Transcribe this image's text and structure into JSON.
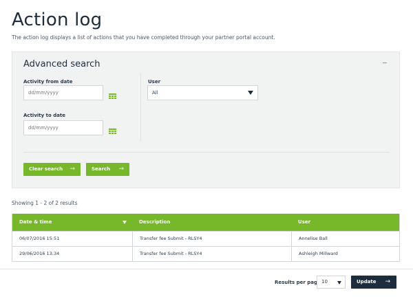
{
  "page": {
    "title": "Action log",
    "intro": "The action log displays a list of actions that you have completed through your partner portal account."
  },
  "advanced_search": {
    "title": "Advanced search",
    "collapse_icon": "minus-icon",
    "activity_from_label": "Activity from date",
    "activity_from_placeholder": "dd/mm/yyyy",
    "activity_to_label": "Activity to date",
    "activity_to_placeholder": "dd/mm/yyyy",
    "calendar_icon": "calendar-icon",
    "user_label": "User",
    "user_selected": "All",
    "clear_label": "Clear search",
    "search_label": "Search",
    "arrow_glyph": "→"
  },
  "results": {
    "count_text": "Showing 1 - 2 of 2 results",
    "columns": [
      "Date & time",
      "Description",
      "User"
    ],
    "rows": [
      [
        "06/07/2016 15:51",
        "Transfer fee Submit - RLSY4",
        "Annelise Ball"
      ],
      [
        "29/06/2016 13:34",
        "Transfer fee Submit - RLSY4",
        "Ashleigh Millward"
      ]
    ]
  },
  "pagination": {
    "per_page_label": "Results per page",
    "per_page_value": "10",
    "update_label": "Update",
    "arrow_glyph": "→"
  },
  "colors": {
    "accent_green": "#76b82a",
    "navy": "#1e2d3d",
    "panel_bg": "#f1f2f2"
  }
}
